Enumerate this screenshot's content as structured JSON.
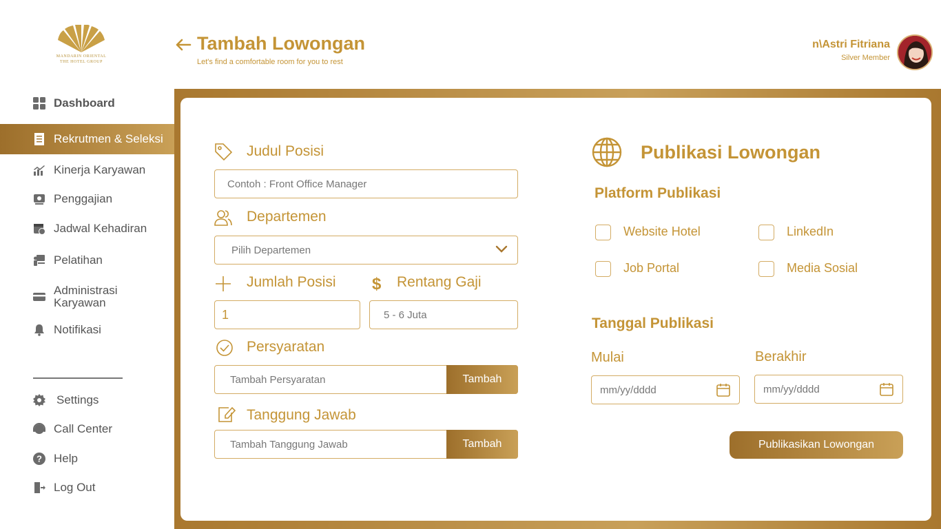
{
  "brand": {
    "logo_line1": "MANDARIN ORIENTAL",
    "logo_line2": "THE HOTEL GROUP"
  },
  "header": {
    "title": "Tambah Lowongan",
    "subtitle": "Let's find a comfortable room for you to rest",
    "user_name": "n\\Astri Fitriana",
    "user_tier": "Silver Member"
  },
  "sidebar": {
    "items": [
      {
        "label": "Dashboard",
        "icon": "dashboard-icon"
      },
      {
        "label": "Rekrutmen & Seleksi",
        "icon": "document-list-icon"
      },
      {
        "label": "Kinerja Karyawan",
        "icon": "chart-icon"
      },
      {
        "label": "Penggajian",
        "icon": "payroll-icon"
      },
      {
        "label": "Jadwal Kehadiran",
        "icon": "calendar-clock-icon"
      },
      {
        "label": "Pelatihan",
        "icon": "training-icon"
      },
      {
        "label": "Administrasi Karyawan",
        "icon": "card-icon"
      },
      {
        "label": "Notifikasi",
        "icon": "bell-icon"
      }
    ],
    "bottom_items": [
      {
        "label": "Settings",
        "icon": "gear-icon"
      },
      {
        "label": "Call Center",
        "icon": "headset-icon"
      },
      {
        "label": "Help",
        "icon": "help-icon"
      },
      {
        "label": "Log Out",
        "icon": "logout-icon"
      }
    ]
  },
  "form": {
    "judul_label": "Judul Posisi",
    "judul_placeholder": "Contoh : Front Office Manager",
    "departemen_label": "Departemen",
    "departemen_value": "Pilih Departemen",
    "jumlah_label": "Jumlah Posisi",
    "jumlah_value": "1",
    "gaji_label": "Rentang Gaji",
    "gaji_placeholder": "5 - 6 Juta",
    "persyaratan_label": "Persyaratan",
    "persyaratan_placeholder": "Tambah Persyaratan",
    "persyaratan_button": "Tambah",
    "tanggung_label": "Tanggung Jawab",
    "tanggung_placeholder": "Tambah Tanggung Jawab",
    "tanggung_button": "Tambah"
  },
  "publish": {
    "title": "Publikasi Lowongan",
    "platform_title": "Platform Publikasi",
    "platforms": [
      "Website Hotel",
      "LinkedIn",
      "Job Portal",
      "Media Sosial"
    ],
    "date_title": "Tanggal Publikasi",
    "start_label": "Mulai",
    "start_placeholder": "mm/yy/dddd",
    "end_label": "Berakhir",
    "end_placeholder": "mm/yy/dddd",
    "submit_button": "Publikasikan Lowongan"
  },
  "colors": {
    "accent": "#c49436",
    "gradient_dark": "#9d6f2b",
    "gradient_light": "#c9a057"
  }
}
